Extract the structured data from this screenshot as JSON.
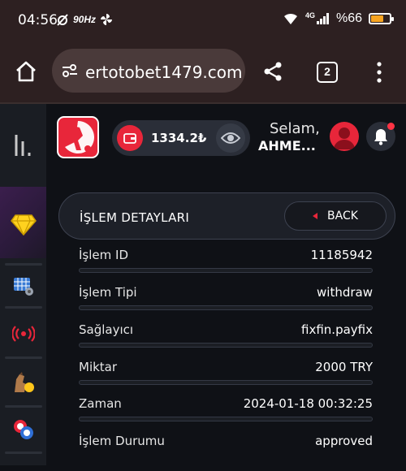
{
  "status_bar": {
    "time": "04:56",
    "refresh_rate": "90Hz",
    "network": "4G",
    "battery": "%66",
    "battery_level_percent": 66
  },
  "browser": {
    "url": "ertotobet1479.com",
    "tab_count": "2"
  },
  "header": {
    "balance": "1334.2₺",
    "greeting": "Selam,",
    "username": "AHME..."
  },
  "details": {
    "title": "İŞLEM DETAYLARI",
    "back_label": "BACK",
    "rows": [
      {
        "label": "İşlem ID",
        "value": "11185942"
      },
      {
        "label": "İşlem Tipi",
        "value": "withdraw"
      },
      {
        "label": "Sağlayıcı",
        "value": "fixfin.payfix"
      },
      {
        "label": "Miktar",
        "value": "2000 TRY"
      },
      {
        "label": "Zaman",
        "value": "2024-01-18 00:32:25"
      },
      {
        "label": "İşlem Durumu",
        "value": "approved"
      }
    ]
  },
  "colors": {
    "accent": "#e8263a",
    "background": "#0f1116",
    "panel": "#1d2028",
    "browser_chrome": "#2d2021"
  },
  "icons": {
    "sidebar": [
      "menu-icon",
      "diamond-icon",
      "casino-grid-icon",
      "live-broadcast-icon",
      "horse-racing-icon",
      "poker-chips-icon"
    ]
  }
}
